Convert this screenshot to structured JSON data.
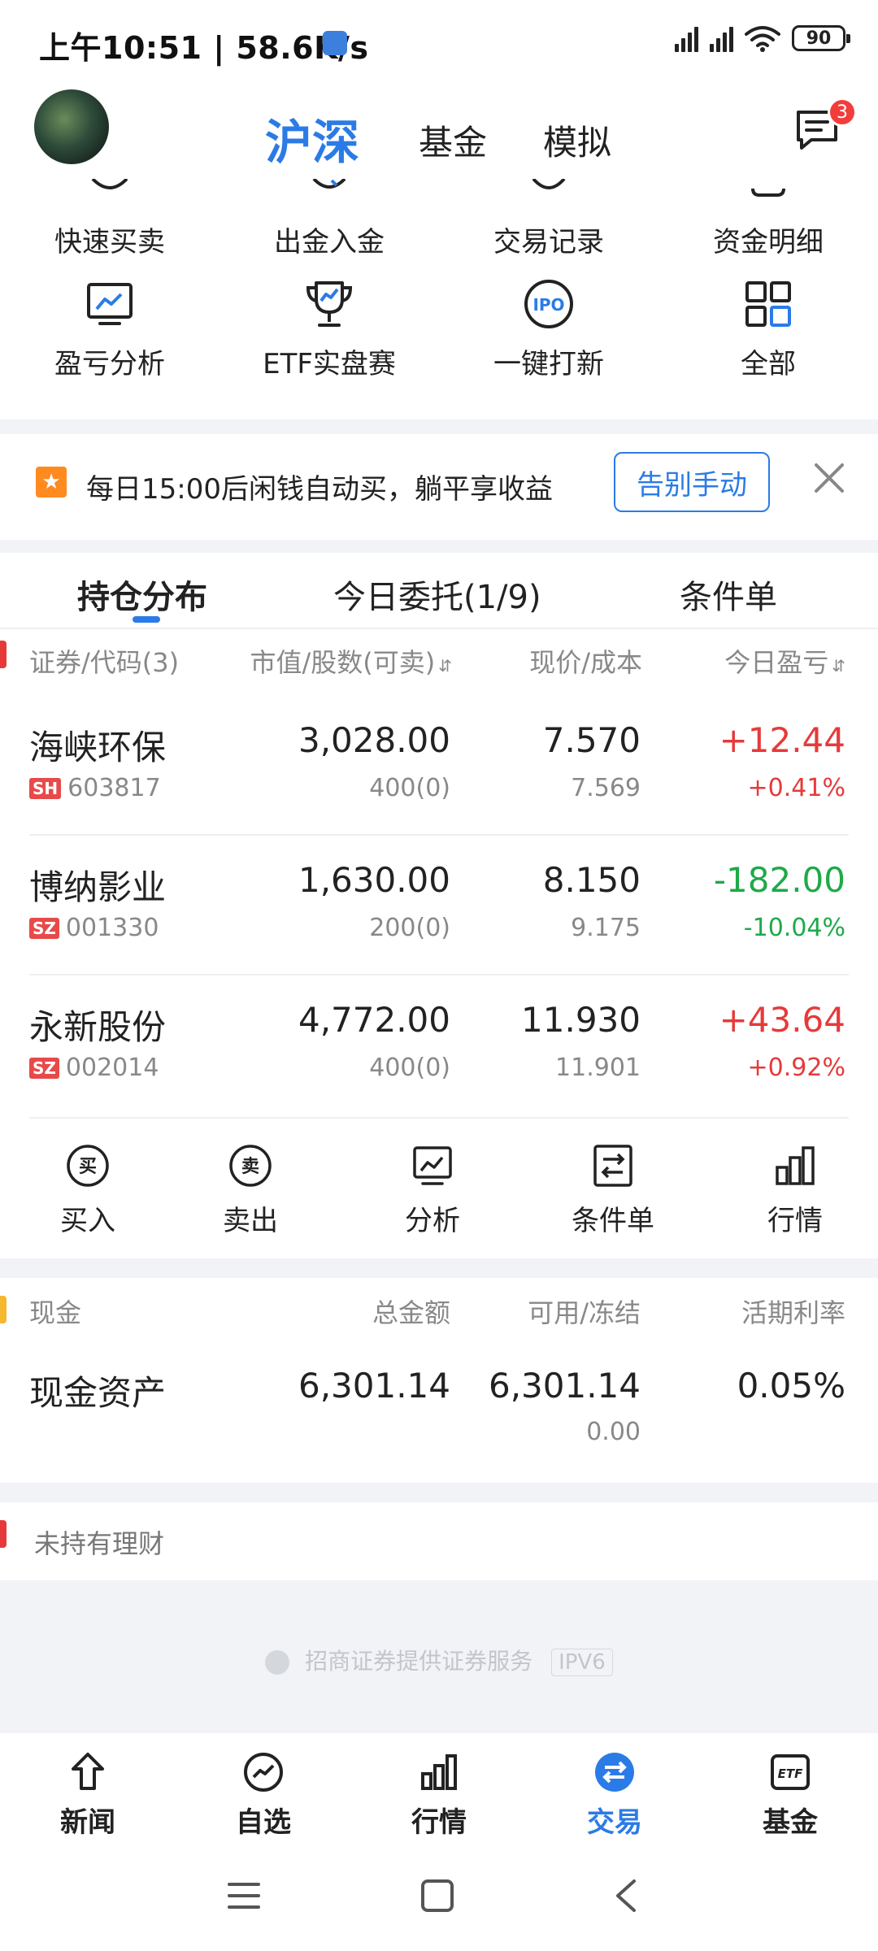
{
  "status_bar": {
    "time": "上午10:51",
    "separator": "|",
    "speed": "58.6K/s",
    "battery": "90"
  },
  "header": {
    "tabs": [
      {
        "label": "沪深",
        "active": true
      },
      {
        "label": "基金",
        "active": false
      },
      {
        "label": "模拟",
        "active": false
      }
    ],
    "message_badge": "3"
  },
  "quick_actions": {
    "row1": [
      "快速买卖",
      "出金入金",
      "交易记录",
      "资金明细"
    ],
    "row2": [
      "盈亏分析",
      "ETF实盘赛",
      "一键打新",
      "全部"
    ],
    "ipo_icon_text": "IPO"
  },
  "promo": {
    "text": "每日15:00后闲钱自动买，躺平享收益",
    "button": "告别手动"
  },
  "holdings": {
    "tabs": [
      "持仓分布",
      "今日委托(1/9)",
      "条件单"
    ],
    "columns": [
      "证券/代码(3)",
      "市值/股数(可卖)",
      "现价/成本",
      "今日盈亏"
    ],
    "rows": [
      {
        "name": "海峡环保",
        "market": "SH",
        "code": "603817",
        "value": "3,028.00",
        "shares": "400(0)",
        "price": "7.570",
        "cost": "7.569",
        "pnl": "+12.44",
        "pnl_pct": "+0.41%",
        "trend": "up"
      },
      {
        "name": "博纳影业",
        "market": "SZ",
        "code": "001330",
        "value": "1,630.00",
        "shares": "200(0)",
        "price": "8.150",
        "cost": "9.175",
        "pnl": "-182.00",
        "pnl_pct": "-10.04%",
        "trend": "down"
      },
      {
        "name": "永新股份",
        "market": "SZ",
        "code": "002014",
        "value": "4,772.00",
        "shares": "400(0)",
        "price": "11.930",
        "cost": "11.901",
        "pnl": "+43.64",
        "pnl_pct": "+0.92%",
        "trend": "up"
      }
    ],
    "actions": [
      "买入",
      "卖出",
      "分析",
      "条件单",
      "行情"
    ],
    "buy_glyph": "买",
    "sell_glyph": "卖"
  },
  "cash": {
    "columns": [
      "现金",
      "总金额",
      "可用/冻结",
      "活期利率"
    ],
    "label": "现金资产",
    "total": "6,301.14",
    "available": "6,301.14",
    "frozen": "0.00",
    "rate": "0.05%"
  },
  "wealth": {
    "label": "未持有理财"
  },
  "footer": {
    "note": "招商证券提供证券服务",
    "tag": "IPV6"
  },
  "bottom_nav": [
    {
      "label": "新闻",
      "icon": "news-icon"
    },
    {
      "label": "自选",
      "icon": "watchlist-icon"
    },
    {
      "label": "行情",
      "icon": "market-icon"
    },
    {
      "label": "交易",
      "icon": "trade-icon",
      "active": true
    },
    {
      "label": "基金",
      "icon": "etf-icon"
    }
  ],
  "colors": {
    "accent": "#2b7be6",
    "up": "#e63a3a",
    "down": "#1fa94a",
    "promo_star": "#ff8a1f"
  }
}
